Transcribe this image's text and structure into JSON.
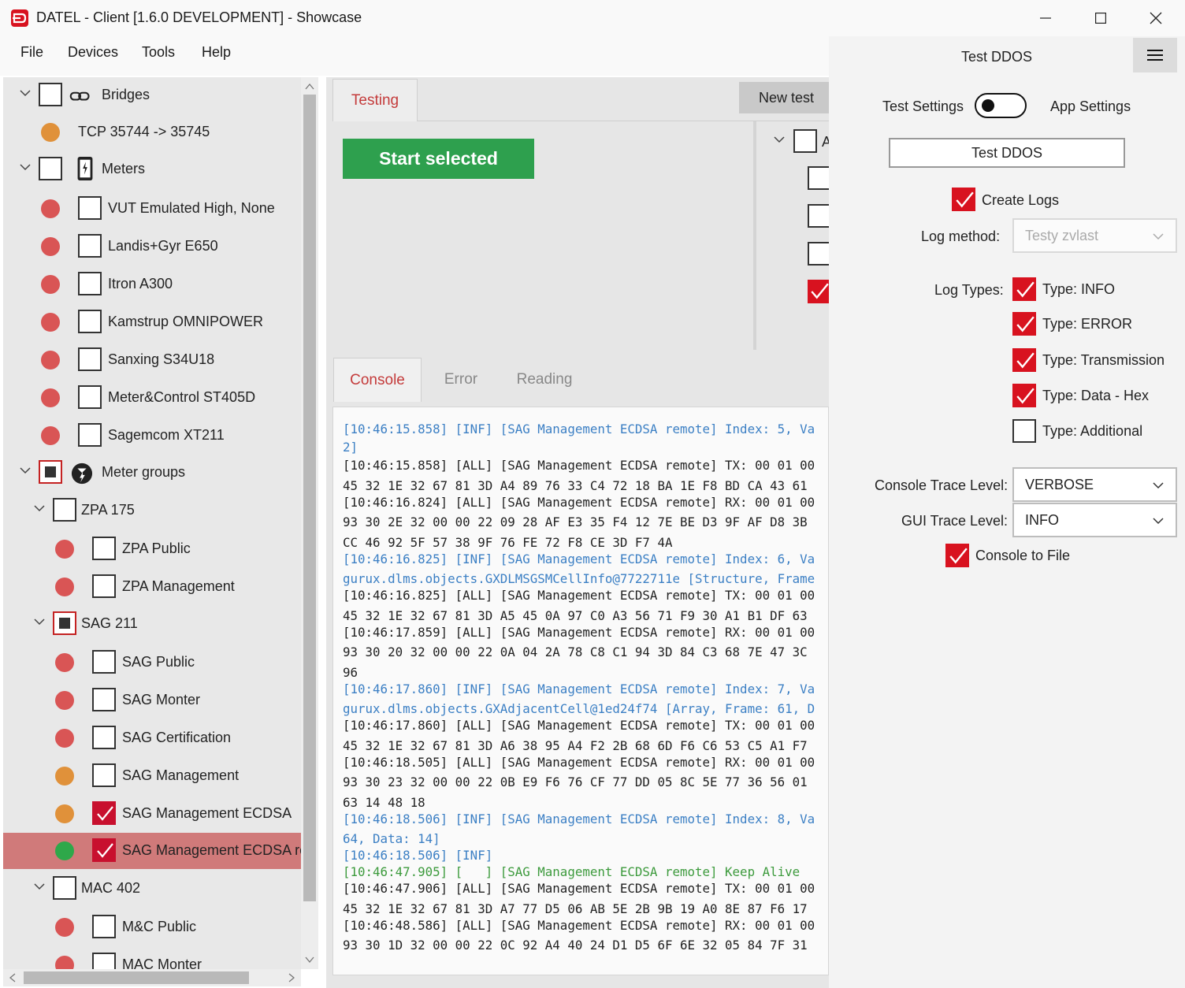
{
  "window": {
    "title": "DATEL - Client [1.6.0 DEVELOPMENT] - Showcase"
  },
  "menu": [
    "File",
    "Devices",
    "Tools",
    "Help"
  ],
  "tree": {
    "bridges_label": "Bridges",
    "bridge_item": "TCP 35744 -> 35745",
    "meters_label": "Meters",
    "meters": [
      {
        "label": "VUT Emulated High, None",
        "status": "red"
      },
      {
        "label": "Landis+Gyr E650",
        "status": "red"
      },
      {
        "label": "Itron A300",
        "status": "red"
      },
      {
        "label": "Kamstrup OMNIPOWER",
        "status": "red"
      },
      {
        "label": "Sanxing S34U18",
        "status": "red"
      },
      {
        "label": "Meter&Control ST405D",
        "status": "red"
      },
      {
        "label": "Sagemcom XT211",
        "status": "red"
      }
    ],
    "meter_groups_label": "Meter groups",
    "group_zpa": "ZPA 175",
    "zpa_items": [
      "ZPA Public",
      "ZPA Management"
    ],
    "group_sag": "SAG 211",
    "sag_items": [
      "SAG Public",
      "SAG Monter",
      "SAG Certification",
      "SAG Management",
      "SAG Management ECDSA",
      "SAG Management ECDSA re"
    ],
    "group_mac": "MAC 402",
    "mac_items": [
      "M&C Public",
      "MAC Monter"
    ]
  },
  "test_area": {
    "tab_testing": "Testing",
    "new_test": "New test",
    "start_selected": "Start selected",
    "partial_label": "A"
  },
  "console_tabs": [
    "Console",
    "Error",
    "Reading"
  ],
  "console_lines": [
    {
      "t": "inf",
      "text": "[10:46:15.858] [INF] [SAG Management ECDSA remote] Index: 5, Va"
    },
    {
      "t": "inf",
      "text": "2]"
    },
    {
      "t": "all",
      "text": "[10:46:15.858] [ALL] [SAG Management ECDSA remote] TX: 00 01 00"
    },
    {
      "t": "all",
      "text": "45 32 1E 32 67 81 3D A4 89 76 33 C4 72 18 BA 1E F8 BD CA 43 61"
    },
    {
      "t": "all",
      "text": "[10:46:16.824] [ALL] [SAG Management ECDSA remote] RX: 00 01 00"
    },
    {
      "t": "all",
      "text": "93 30 2E 32 00 00 22 09 28 AF E3 35 F4 12 7E BE D3 9F AF D8 3B"
    },
    {
      "t": "all",
      "text": "CC 46 92 5F 57 38 9F 76 FE 72 F8 CE 3D F7 4A"
    },
    {
      "t": "inf",
      "text": "[10:46:16.825] [INF] [SAG Management ECDSA remote] Index: 6, Va"
    },
    {
      "t": "inf",
      "text": "gurux.dlms.objects.GXDLMSGSMCellInfo@7722711e [Structure, Frame"
    },
    {
      "t": "all",
      "text": "[10:46:16.825] [ALL] [SAG Management ECDSA remote] TX: 00 01 00"
    },
    {
      "t": "all",
      "text": "45 32 1E 32 67 81 3D A5 45 0A 97 C0 A3 56 71 F9 30 A1 B1 DF 63"
    },
    {
      "t": "all",
      "text": "[10:46:17.859] [ALL] [SAG Management ECDSA remote] RX: 00 01 00"
    },
    {
      "t": "all",
      "text": "93 30 20 32 00 00 22 0A 04 2A 78 C8 C1 94 3D 84 C3 68 7E 47 3C"
    },
    {
      "t": "all",
      "text": "96"
    },
    {
      "t": "inf",
      "text": "[10:46:17.860] [INF] [SAG Management ECDSA remote] Index: 7, Va"
    },
    {
      "t": "inf",
      "text": "gurux.dlms.objects.GXAdjacentCell@1ed24f74 [Array, Frame: 61, D"
    },
    {
      "t": "all",
      "text": "[10:46:17.860] [ALL] [SAG Management ECDSA remote] TX: 00 01 00"
    },
    {
      "t": "all",
      "text": "45 32 1E 32 67 81 3D A6 38 95 A4 F2 2B 68 6D F6 C6 53 C5 A1 F7"
    },
    {
      "t": "all",
      "text": "[10:46:18.505] [ALL] [SAG Management ECDSA remote] RX: 00 01 00"
    },
    {
      "t": "all",
      "text": "93 30 23 32 00 00 22 0B E9 F6 76 CF 77 DD 05 8C 5E 77 36 56 01"
    },
    {
      "t": "all",
      "text": "63 14 48 18"
    },
    {
      "t": "inf",
      "text": "[10:46:18.506] [INF] [SAG Management ECDSA remote] Index: 8, Va"
    },
    {
      "t": "inf",
      "text": "64, Data: 14]"
    },
    {
      "t": "inf",
      "text": "[10:46:18.506] [INF]"
    },
    {
      "t": "ka",
      "text": "[10:46:47.905] [   ] [SAG Management ECDSA remote] Keep Alive"
    },
    {
      "t": "all",
      "text": "[10:46:47.906] [ALL] [SAG Management ECDSA remote] TX: 00 01 00"
    },
    {
      "t": "all",
      "text": "45 32 1E 32 67 81 3D A7 77 D5 06 AB 5E 2B 9B 19 A0 8E 87 F6 17"
    },
    {
      "t": "all",
      "text": "[10:46:48.586] [ALL] [SAG Management ECDSA remote] RX: 00 01 00"
    },
    {
      "t": "all",
      "text": "93 30 1D 32 00 00 22 0C 92 A4 40 24 D1 D5 6F 6E 32 05 84 7F 31"
    }
  ],
  "right_panel": {
    "title": "Test DDOS",
    "test_settings": "Test Settings",
    "app_settings": "App Settings",
    "ddos_button": "Test DDOS",
    "create_logs": "Create Logs",
    "log_method_label": "Log method:",
    "log_method_value": "Testy zvlast",
    "log_types_label": "Log Types:",
    "log_types": [
      {
        "label": "Type: INFO",
        "checked": true
      },
      {
        "label": "Type: ERROR",
        "checked": true
      },
      {
        "label": "Type: Transmission",
        "checked": true
      },
      {
        "label": "Type: Data - Hex",
        "checked": true
      },
      {
        "label": "Type: Additional",
        "checked": false
      }
    ],
    "console_trace_label": "Console Trace Level:",
    "console_trace_value": "VERBOSE",
    "gui_trace_label": "GUI Trace Level:",
    "gui_trace_value": "INFO",
    "console_to_file": "Console to File"
  },
  "colors": {
    "accent_red": "#d8121f",
    "start_green": "#2ea04e",
    "selected_row": "#d07a7a",
    "info_blue": "#3b7fc4"
  }
}
